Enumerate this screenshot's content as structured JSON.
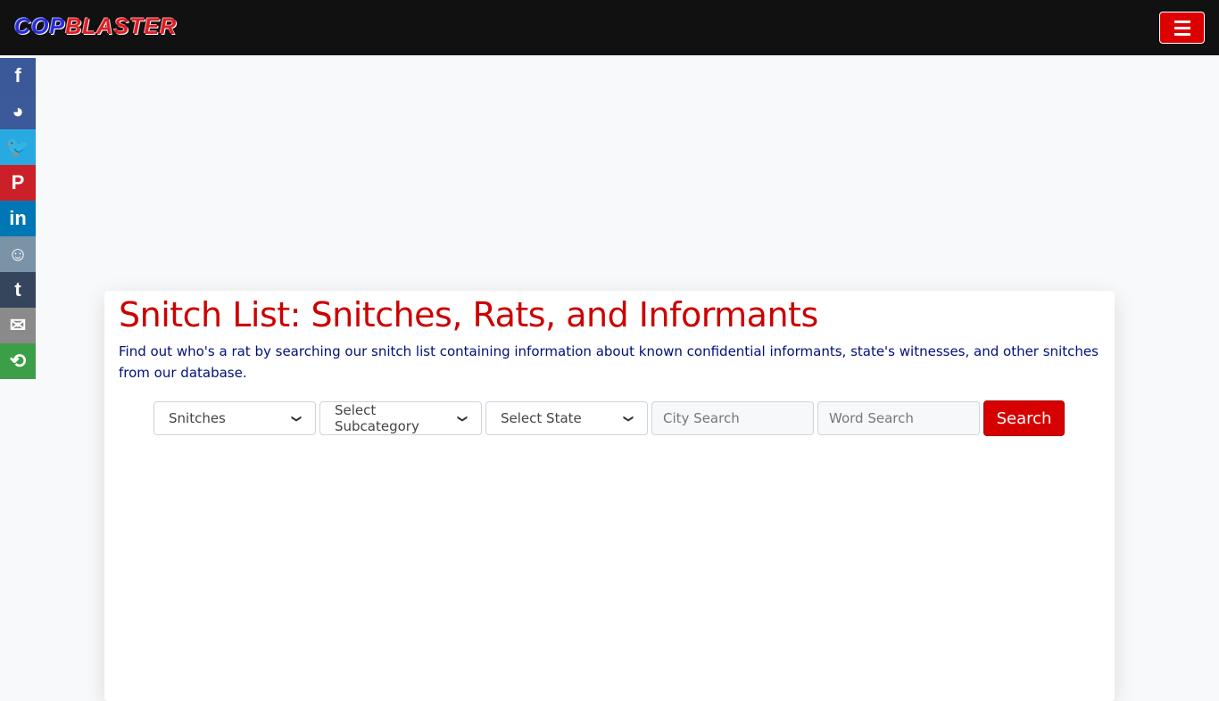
{
  "header": {
    "logo_part1": "COP",
    "logo_part2": "BLASTER",
    "menu_icon": "hamburger-icon"
  },
  "share": [
    {
      "name": "facebook",
      "glyph": "f",
      "color": "#3b5998"
    },
    {
      "name": "messenger",
      "glyph": "◕",
      "color": "#3c5a99"
    },
    {
      "name": "twitter",
      "glyph": "🐦",
      "color": "#29a9e1"
    },
    {
      "name": "pinterest",
      "glyph": "P",
      "color": "#cb2027"
    },
    {
      "name": "linkedin",
      "glyph": "in",
      "color": "#0077b5"
    },
    {
      "name": "reddit",
      "glyph": "☺",
      "color": "#7a93a7"
    },
    {
      "name": "tumblr",
      "glyph": "t",
      "color": "#35465c"
    },
    {
      "name": "email",
      "glyph": "✉",
      "color": "#8a8a8a"
    },
    {
      "name": "more",
      "glyph": "⟲",
      "color": "#3d9e48"
    }
  ],
  "main": {
    "title": "Snitch List: Snitches, Rats, and Informants",
    "description": "Find out who's a rat by searching our snitch list containing information about known confidential informants, state's witnesses, and other snitches from our database.",
    "form": {
      "category": "Snitches",
      "subcategory": "Select Subcategory",
      "state": "Select State",
      "city_placeholder": "City Search",
      "word_placeholder": "Word Search",
      "search_label": "Search"
    }
  }
}
